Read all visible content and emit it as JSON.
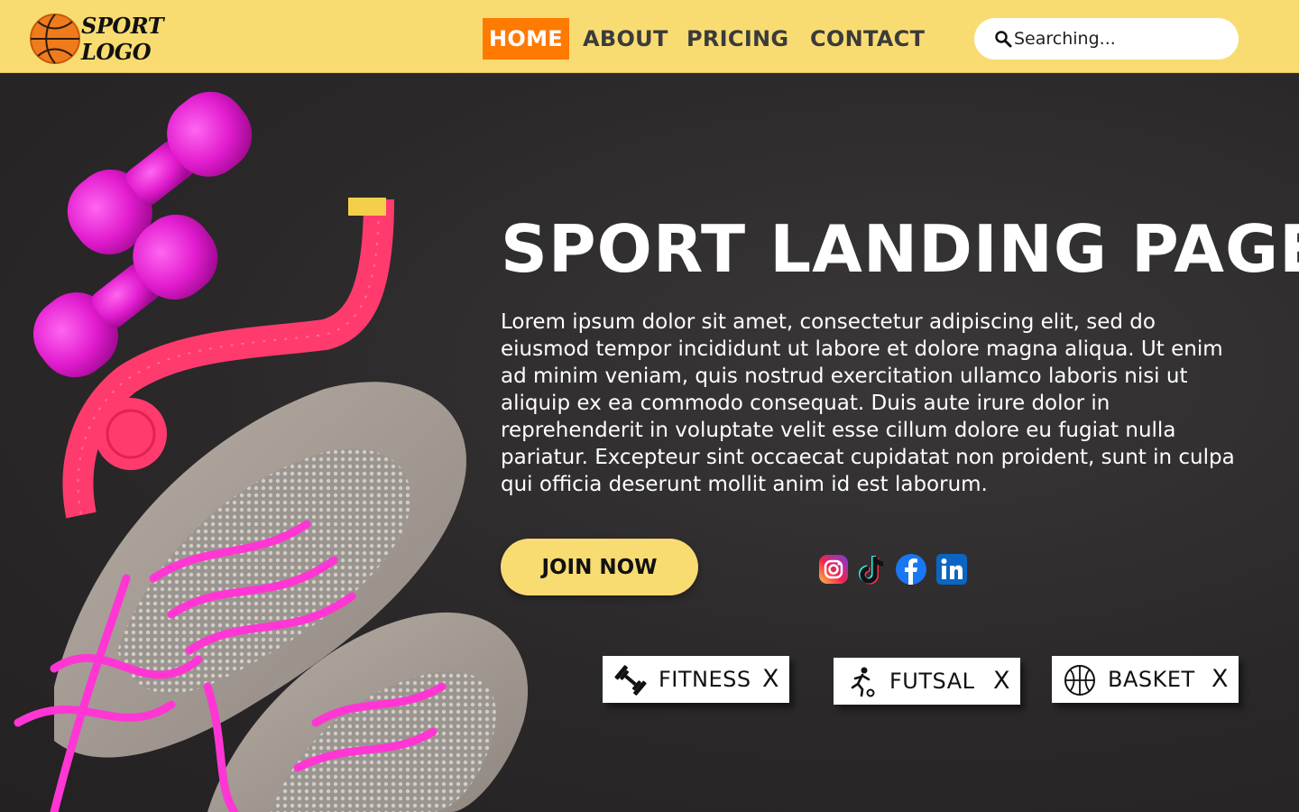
{
  "header": {
    "logo": {
      "line1": "SPORT",
      "line2": "LOGO",
      "icon": "basketball-icon"
    },
    "nav": [
      {
        "label": "HOME",
        "active": true
      },
      {
        "label": "ABOUT",
        "active": false
      },
      {
        "label": "PRICING",
        "active": false
      },
      {
        "label": "CONTACT",
        "active": false
      }
    ],
    "search": {
      "placeholder": "Searching...",
      "icon": "search-icon"
    }
  },
  "hero": {
    "title": "SPORT LANDING PAGE",
    "body": "Lorem ipsum dolor sit amet, consectetur adipiscing elit, sed do eiusmod tempor incididunt ut labore et dolore magna aliqua. Ut enim ad minim veniam, quis nostrud exercitation ullamco laboris nisi ut aliquip ex ea commodo consequat. Duis aute irure dolor in reprehenderit in voluptate velit esse cillum dolore eu fugiat nulla pariatur. Excepteur sint occaecat cupidatat non proident, sunt in culpa qui officia deserunt mollit anim id est laborum.",
    "cta": "JOIN NOW",
    "social": [
      {
        "name": "instagram-icon"
      },
      {
        "name": "tiktok-icon"
      },
      {
        "name": "facebook-icon"
      },
      {
        "name": "linkedin-icon"
      }
    ]
  },
  "chips": [
    {
      "label": "FITNESS",
      "close": "X",
      "icon": "dumbbell-icon"
    },
    {
      "label": "FUTSAL",
      "close": "X",
      "icon": "soccer-player-icon"
    },
    {
      "label": "BASKET",
      "close": "X",
      "icon": "basketball-outline-icon"
    }
  ],
  "colors": {
    "header_bg": "#f8dc72",
    "nav_active": "#ff7a00",
    "cta_bg": "#f8dc72",
    "hero_bg": "#2a2829"
  }
}
